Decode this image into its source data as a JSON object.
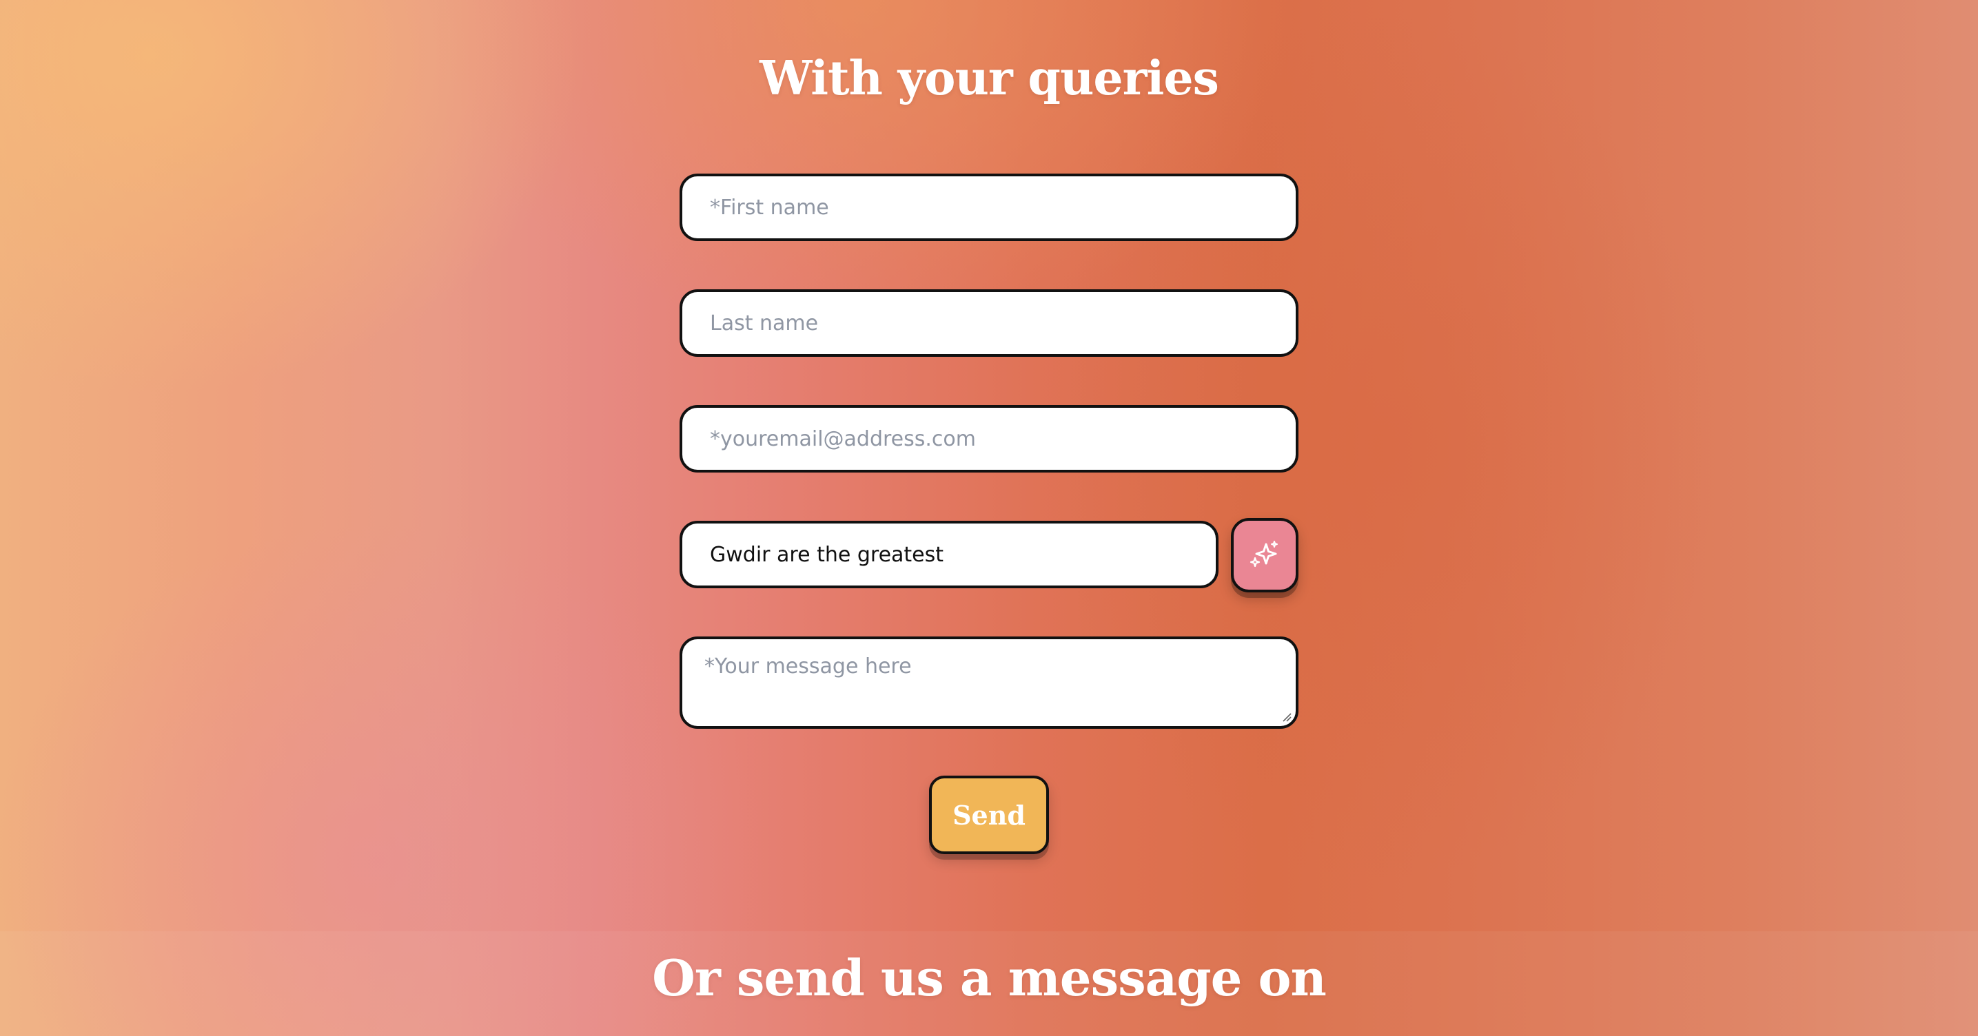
{
  "colors": {
    "button_primary": "#f1b657",
    "button_secondary": "#ea8694",
    "text_on_bg": "#ffffff",
    "field_border": "#111111"
  },
  "headings": {
    "top": "With your queries",
    "bottom": "Or send us a message on"
  },
  "form": {
    "first_name": {
      "placeholder": "*First name",
      "value": ""
    },
    "last_name": {
      "placeholder": "Last name",
      "value": ""
    },
    "email": {
      "placeholder": "*youremail@address.com",
      "value": ""
    },
    "subject": {
      "placeholder": "",
      "value": "Gwdir are the greatest"
    },
    "message": {
      "placeholder": "*Your message here",
      "value": ""
    },
    "send_label": "Send",
    "sparkle_icon": "sparkles-icon"
  }
}
